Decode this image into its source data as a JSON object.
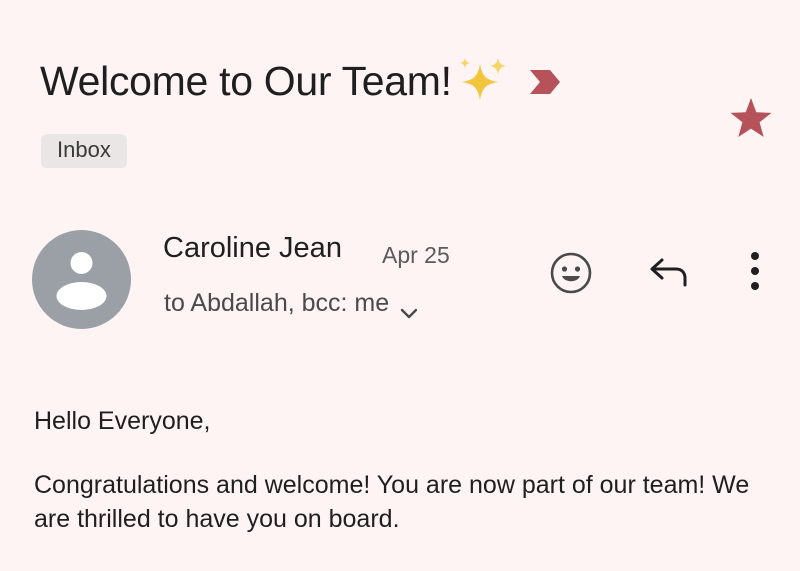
{
  "email": {
    "subject": "Welcome to Our Team!",
    "subject_emoji": "sparkles-icon",
    "label": "Inbox",
    "sender": {
      "name": "Caroline Jean",
      "date": "Apr 25",
      "recipients": "to Abdallah, bcc: me"
    },
    "body": {
      "greeting": "Hello Everyone,",
      "paragraph": "Congratulations and welcome! You are now part of our team! We are thrilled to have you on board."
    }
  },
  "colors": {
    "background": "#fdf4f3",
    "important_marker": "#b5525a",
    "starred": "#b5525a",
    "avatar": "#9aa0a6",
    "sparkle": "#f2c53d"
  },
  "icons": [
    "sparkles-icon",
    "important-marker-icon",
    "star-icon",
    "avatar-icon",
    "chevron-down-icon",
    "emoji-reaction-icon",
    "reply-icon",
    "more-vert-icon"
  ]
}
